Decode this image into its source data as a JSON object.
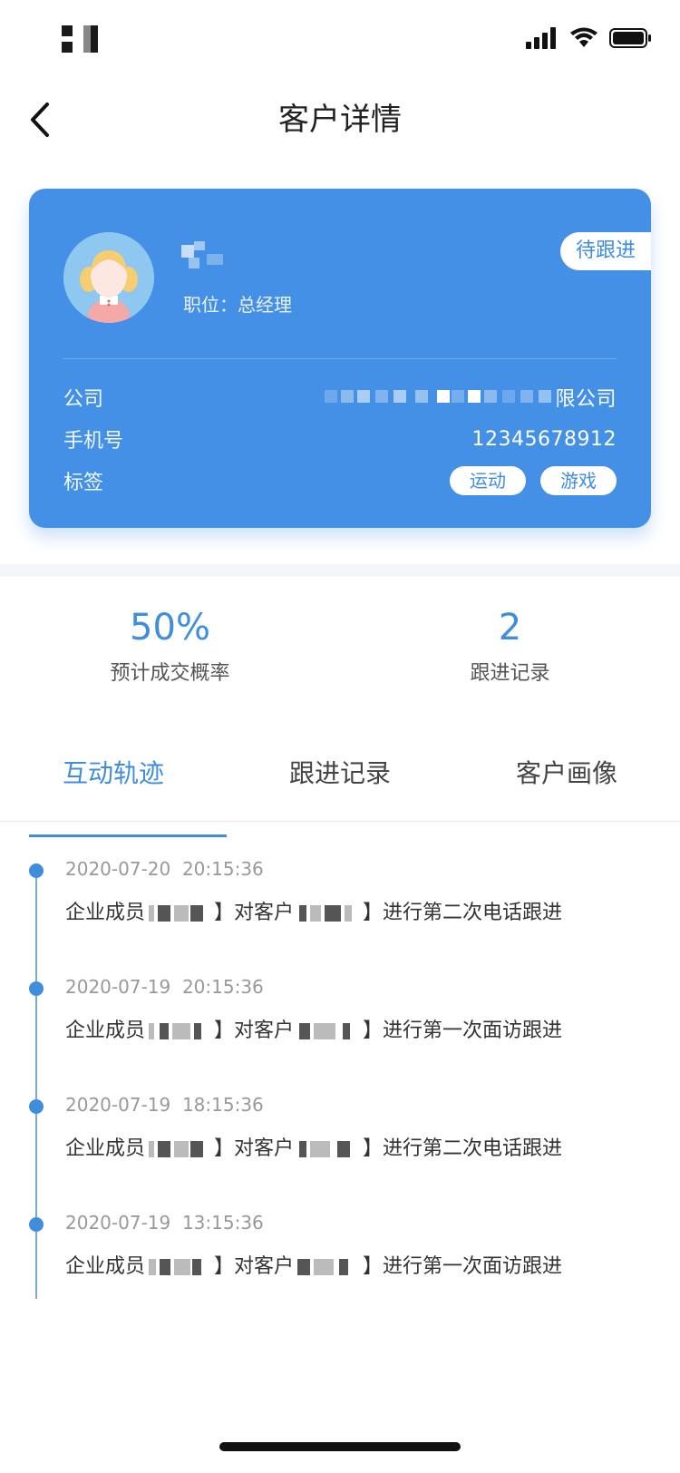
{
  "nav": {
    "title": "客户详情"
  },
  "customer": {
    "position_label": "职位：",
    "position_value": "总经理",
    "status_tag": "待跟进",
    "company_label": "公司",
    "company_value_visible": "限公司",
    "phone_label": "手机号",
    "phone_value": "12345678912",
    "tags_label": "标签",
    "tags": [
      "运动",
      "游戏"
    ]
  },
  "stats": [
    {
      "value": "50%",
      "label": "预计成交概率"
    },
    {
      "value": "2",
      "label": "跟进记录"
    }
  ],
  "tabs": [
    {
      "label": "互动轨迹",
      "active": true
    },
    {
      "label": "跟进记录",
      "active": false
    },
    {
      "label": "客户画像",
      "active": false
    }
  ],
  "timeline": [
    {
      "date": "2020-07-20",
      "time": "20:15:36",
      "prefix": "企业成员",
      "mid": "】对客户",
      "suffix": "】进行第二次电话跟进"
    },
    {
      "date": "2020-07-19",
      "time": "20:15:36",
      "prefix": "企业成员",
      "mid": "】对客户",
      "suffix": "】进行第一次面访跟进"
    },
    {
      "date": "2020-07-19",
      "time": "18:15:36",
      "prefix": "企业成员",
      "mid": "】对客户",
      "suffix": "】进行第二次电话跟进"
    },
    {
      "date": "2020-07-19",
      "time": "13:15:36",
      "prefix": "企业成员",
      "mid": "】对客户",
      "suffix": "】进行第一次面访跟进"
    }
  ],
  "colors": {
    "primary": "#4390e6",
    "accent_text": "#3f8ede"
  },
  "icons": [
    "back-arrow-icon",
    "signal-icon",
    "wifi-icon",
    "battery-icon"
  ]
}
